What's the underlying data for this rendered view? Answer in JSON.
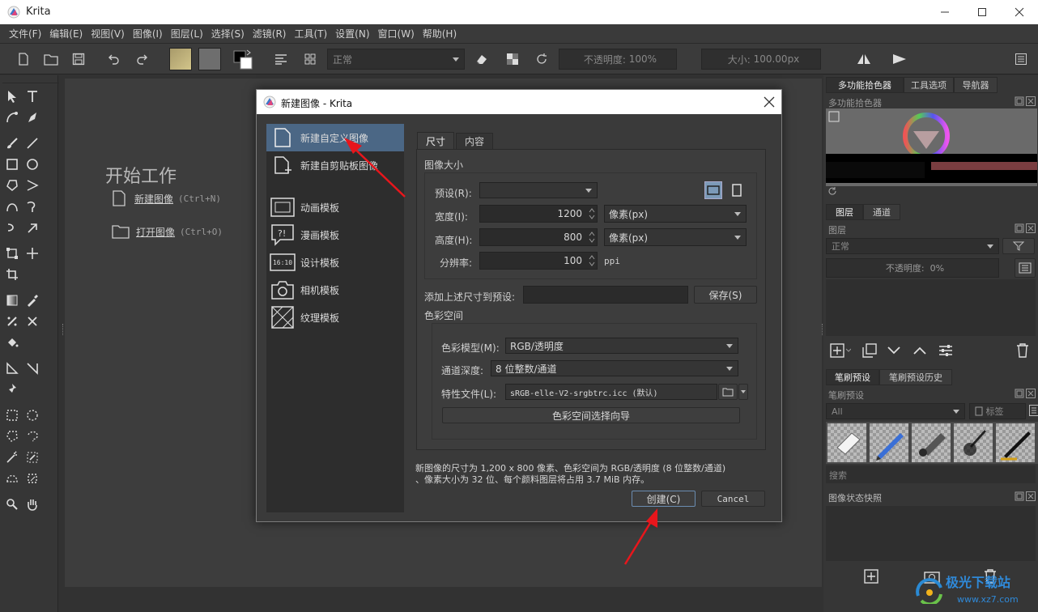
{
  "window": {
    "title": "Krita",
    "minimize": "minimize",
    "maximize": "maximize",
    "close": "close"
  },
  "menu": [
    "文件(F)",
    "编辑(E)",
    "视图(V)",
    "图像(I)",
    "图层(L)",
    "选择(S)",
    "滤镜(R)",
    "工具(T)",
    "设置(N)",
    "窗口(W)",
    "帮助(H)"
  ],
  "toolbar": {
    "blend_mode": "正常",
    "opacity_label": "不透明度:",
    "opacity_value": "100%",
    "size_label": "大小:",
    "size_value": "100.00px"
  },
  "welcome": {
    "heading": "开始工作",
    "new_image": "新建图像",
    "new_shortcut": "(Ctrl+N)",
    "open_image": "打开图像",
    "open_shortcut": "(Ctrl+O)"
  },
  "dialog": {
    "title": "新建图像 - Krita",
    "categories": [
      {
        "label": "新建自定义图像",
        "icon": "document-icon"
      },
      {
        "label": "新建自剪贴板图像",
        "icon": "clipboard-icon"
      },
      {
        "label": "动画模板",
        "icon": "film-icon"
      },
      {
        "label": "漫画模板",
        "icon": "comic-icon"
      },
      {
        "label": "设计模板",
        "icon": "ratio-icon",
        "badge": "16:10"
      },
      {
        "label": "相机模板",
        "icon": "camera-icon"
      },
      {
        "label": "纹理模板",
        "icon": "texture-icon"
      }
    ],
    "tabs": [
      "尺寸",
      "内容"
    ],
    "image_size_title": "图像大小",
    "preset_label": "预设(R):",
    "preset_value": "",
    "width_label": "宽度(I):",
    "width_value": "1200",
    "width_unit": "像素(px)",
    "height_label": "高度(H):",
    "height_value": "800",
    "height_unit": "像素(px)",
    "resolution_label": "分辨率:",
    "resolution_value": "100",
    "resolution_unit": "ppi",
    "add_preset_label": "添加上述尺寸到预设:",
    "add_preset_value": "",
    "save_button": "保存(S)",
    "color_space_title": "色彩空间",
    "color_model_label": "色彩模型(M):",
    "color_model_value": "RGB/透明度",
    "channel_depth_label": "通道深度:",
    "channel_depth_value": "8 位整数/通道",
    "profile_label": "特性文件(L):",
    "profile_value": "sRGB-elle-V2-srgbtrc.icc (默认)",
    "color_wizard_button": "色彩空间选择向导",
    "summary_line1": "新图像的尺寸为 1,200 x 800 像素、色彩空间为 RGB/透明度 (8 位整数/通道)",
    "summary_line2": "、像素大小为 32 位、每个颜料图层将占用 3.7 MiB 内存。",
    "create_button": "创建(C)",
    "cancel_button": "Cancel"
  },
  "docker": {
    "top_tabs": [
      "多功能拾色器",
      "工具选项",
      "导航器"
    ],
    "color_selector_title": "多功能拾色器",
    "layer_tabs": [
      "图层",
      "通道"
    ],
    "layers_title": "图层",
    "layer_blend": "正常",
    "layer_opacity_label": "不透明度:",
    "layer_opacity_value": "0%",
    "brush_tabs": [
      "笔刷预设",
      "笔刷预设历史"
    ],
    "brush_presets_title": "笔刷预设",
    "brush_filter": "All",
    "brush_tag": "标签",
    "brush_search": "搜索",
    "snapshot_title": "图像状态快照"
  },
  "watermark": {
    "brand": "极光下载站",
    "url": "www.xz7.com"
  },
  "colors": {
    "accent": "#4b6785",
    "annotation": "#e8161c"
  }
}
